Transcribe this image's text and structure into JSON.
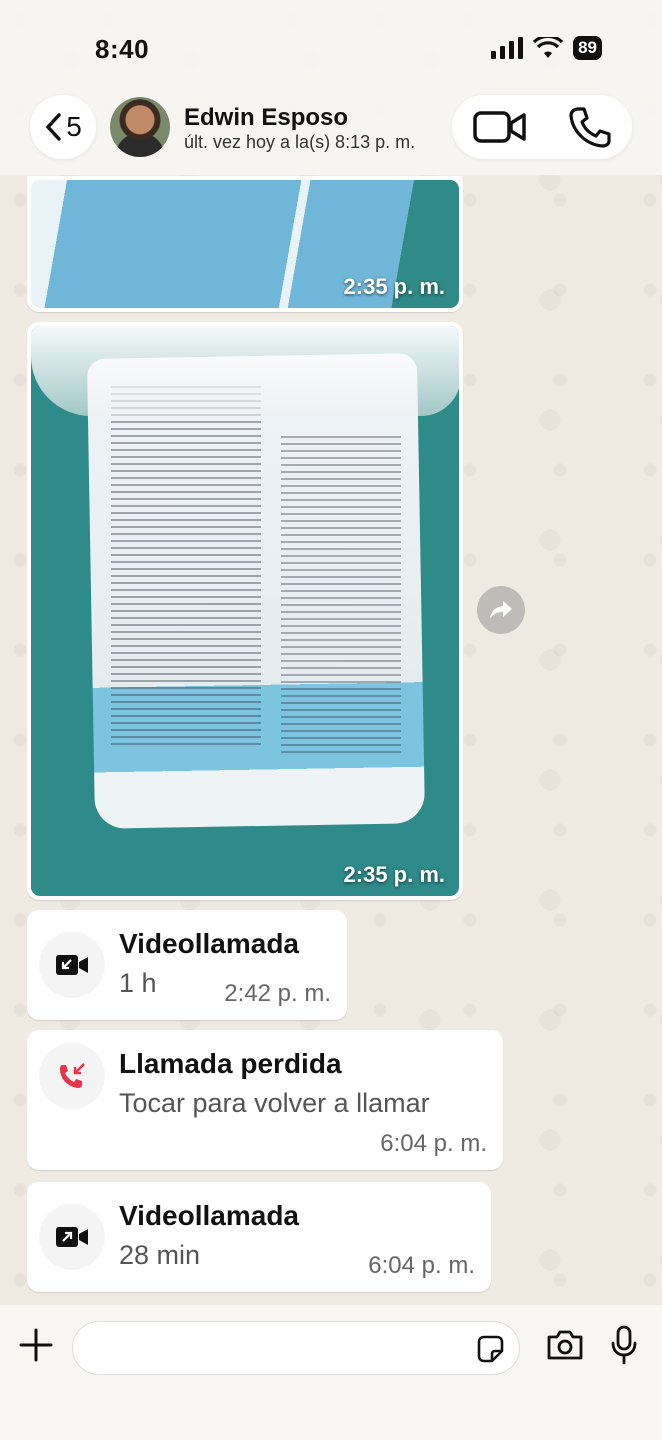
{
  "status_bar": {
    "time": "8:40",
    "battery": "89"
  },
  "header": {
    "back_count": "5",
    "contact_name": "Edwin Esposo",
    "last_seen": "últ. vez hoy a la(s) 8:13 p. m."
  },
  "messages": [
    {
      "type": "image",
      "time": "2:35 p. m."
    },
    {
      "type": "image",
      "time": "2:35 p. m."
    },
    {
      "type": "call",
      "title": "Videollamada",
      "sub": "1 h",
      "time": "2:42 p. m.",
      "icon": "video-incoming-icon"
    },
    {
      "type": "call",
      "title": "Llamada perdida",
      "sub": "Tocar para volver a llamar",
      "time": "6:04 p. m.",
      "icon": "missed-call-icon",
      "accent": "#e8344a"
    },
    {
      "type": "call",
      "title": "Videollamada",
      "sub": "28 min",
      "time": "6:04 p. m.",
      "icon": "video-outgoing-icon"
    }
  ],
  "composer": {
    "placeholder": ""
  },
  "colors": {
    "wallpaper": "#efeae2",
    "bubble": "#ffffff",
    "missed": "#e8344a"
  }
}
